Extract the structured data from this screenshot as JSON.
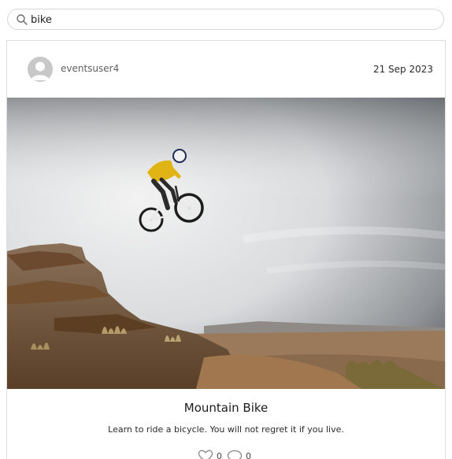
{
  "search": {
    "value": "bike",
    "icon": "search-icon"
  },
  "post": {
    "author": "eventsuser4",
    "date": "21 Sep 2023",
    "image_subject": "",
    "title": "Mountain Bike",
    "description": "Learn to ride a bicycle. You will not regret it if you live.",
    "likes": "0",
    "comments": "0",
    "like_icon": "heart-outline-icon",
    "comment_icon": "speech-bubble-icon"
  },
  "colors": {
    "border": "#dedede",
    "avatar_bg": "#c8c8c8",
    "text": "#212121",
    "muted": "#5f5f5f"
  }
}
